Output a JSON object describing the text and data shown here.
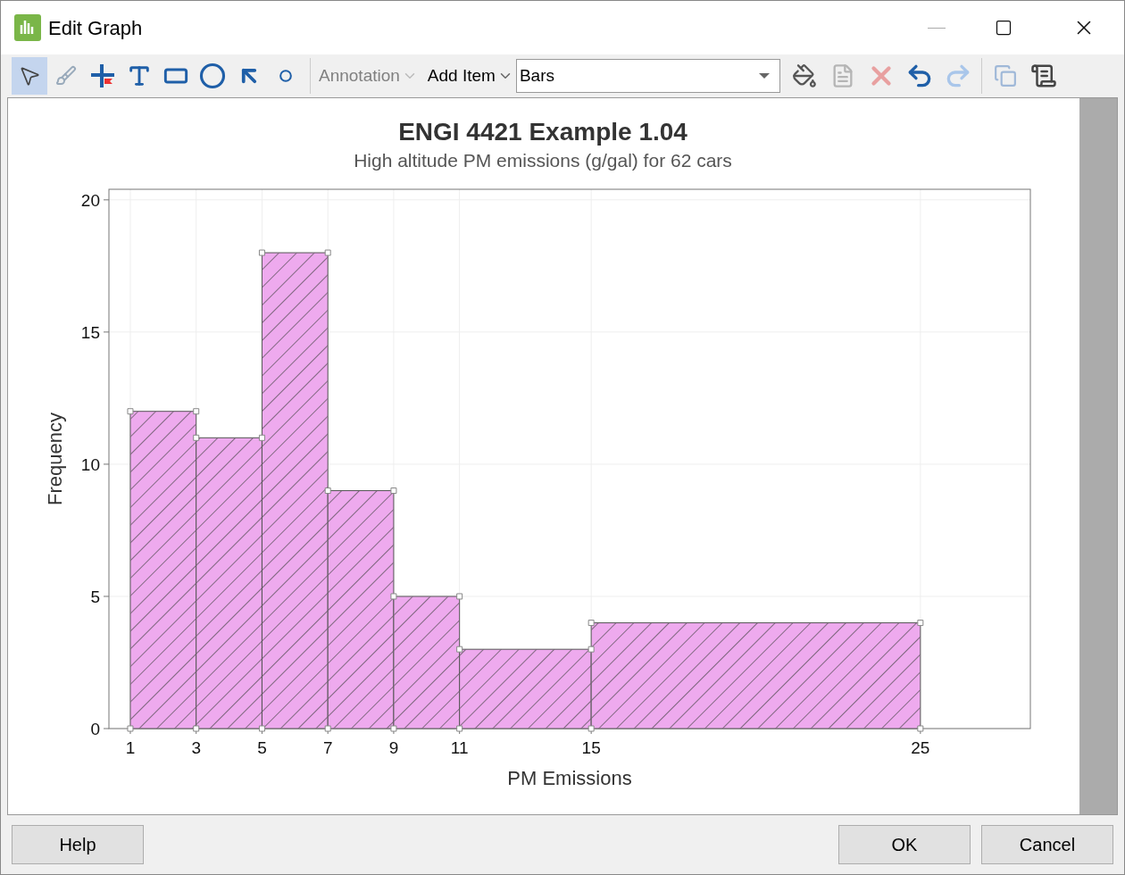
{
  "window": {
    "title": "Edit Graph"
  },
  "toolbar": {
    "tools": [
      {
        "kind": "pointer",
        "selected": true
      },
      {
        "kind": "brush",
        "selected": false
      },
      {
        "kind": "marker",
        "selected": false
      },
      {
        "kind": "text",
        "selected": false
      },
      {
        "kind": "rectangle",
        "selected": false
      },
      {
        "kind": "ellipse",
        "selected": false
      },
      {
        "kind": "arrow",
        "selected": false
      },
      {
        "kind": "dot",
        "selected": false
      }
    ],
    "annotation_menu": {
      "label": "Annotation",
      "disabled": true
    },
    "add_item_menu": {
      "label": "Add Item",
      "disabled": false
    },
    "item_select": {
      "value": "Bars"
    },
    "actions": [
      {
        "kind": "fill",
        "disabled": false
      },
      {
        "kind": "properties",
        "disabled": true
      },
      {
        "kind": "delete",
        "disabled": true
      },
      {
        "kind": "undo",
        "disabled": false
      },
      {
        "kind": "redo",
        "disabled": true
      },
      {
        "kind": "text-copy",
        "disabled": true
      },
      {
        "kind": "scroll",
        "disabled": false
      }
    ]
  },
  "graph": {
    "bars_selected": true,
    "chart_data": {
      "type": "bar",
      "title": "ENGI 4421 Example 1.04",
      "subtitle": "High altitude PM emissions (g/gal) for 62 cars",
      "xlabel": "PM Emissions",
      "ylabel": "Frequency",
      "x": [
        2,
        4,
        6,
        8,
        10,
        13,
        20
      ],
      "series": [
        {
          "color": "#eeaaee",
          "values": [
            12,
            11,
            18,
            9,
            5,
            3,
            4
          ]
        }
      ],
      "grid": true,
      "xlim": [
        0.35,
        28.34
      ],
      "ylim": [
        0,
        20.4
      ],
      "xticks": [
        1,
        3,
        5,
        7,
        9,
        11,
        15,
        25
      ],
      "yticks": [
        0,
        5,
        10,
        15,
        20
      ]
    }
  },
  "buttons": [
    {
      "kind": "help",
      "label": "Help"
    },
    {
      "kind": "ok",
      "label": "OK"
    },
    {
      "kind": "cancel",
      "label": "Cancel"
    }
  ]
}
